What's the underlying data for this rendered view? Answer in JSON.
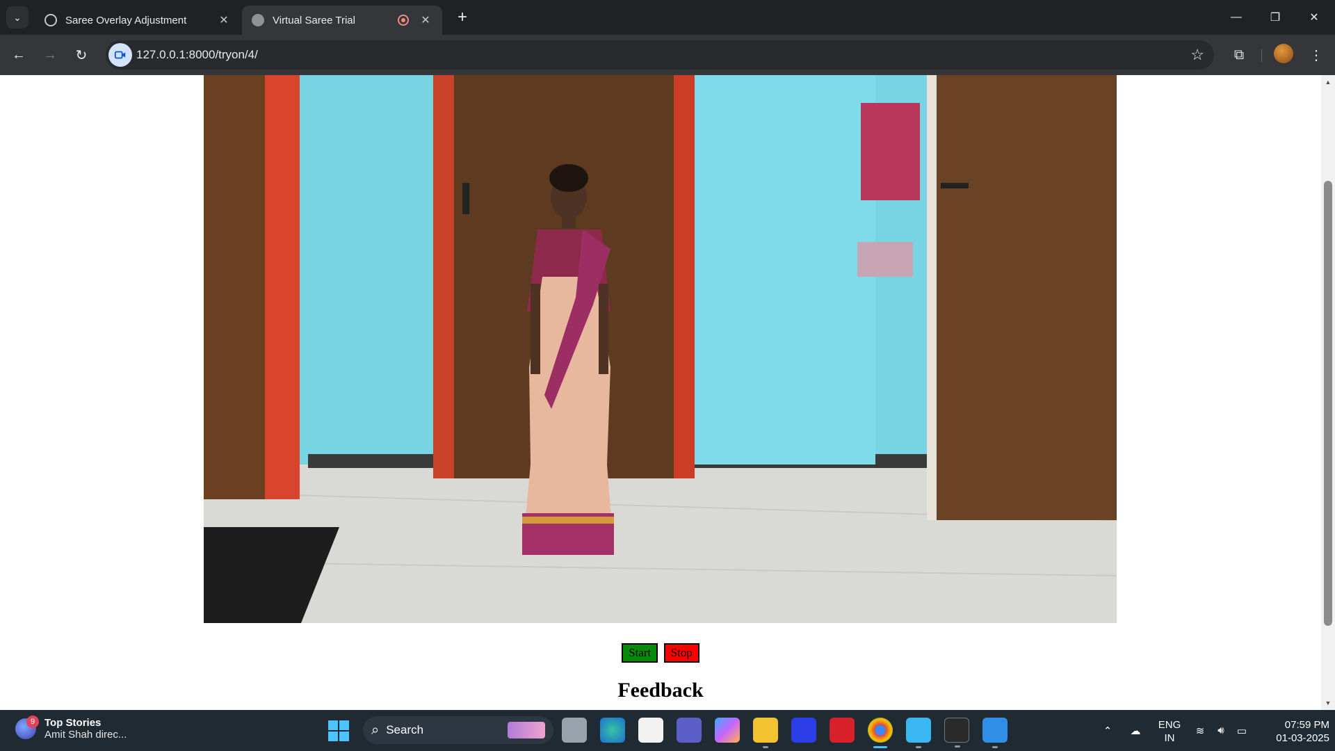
{
  "browser": {
    "tabs": [
      {
        "title": "Saree Overlay Adjustment",
        "active": false
      },
      {
        "title": "Virtual Saree Trial",
        "active": true,
        "recording": true
      }
    ],
    "url": "127.0.0.1:8000/tryon/4/"
  },
  "page": {
    "video_alt": "Webcam feed of a person wearing a virtual saree overlay in a room with wooden doors and blue walls",
    "buttons": {
      "start": "Start",
      "stop": "Stop"
    },
    "feedback_heading": "Feedback",
    "colors": {
      "start_button": "#0a8a0a",
      "stop_button": "#ff0000"
    }
  },
  "taskbar": {
    "news": {
      "badge": "9",
      "title": "Top Stories",
      "subtitle": "Amit Shah direc..."
    },
    "search_label": "Search",
    "apps": [
      "task-view",
      "edge",
      "microsoft-store",
      "teams",
      "copilot",
      "file-explorer",
      "mathway",
      "mcafee",
      "chrome",
      "notepad",
      "terminal",
      "photos"
    ],
    "language": {
      "line1": "ENG",
      "line2": "IN"
    },
    "time": "07:59 PM",
    "date": "01-03-2025"
  }
}
